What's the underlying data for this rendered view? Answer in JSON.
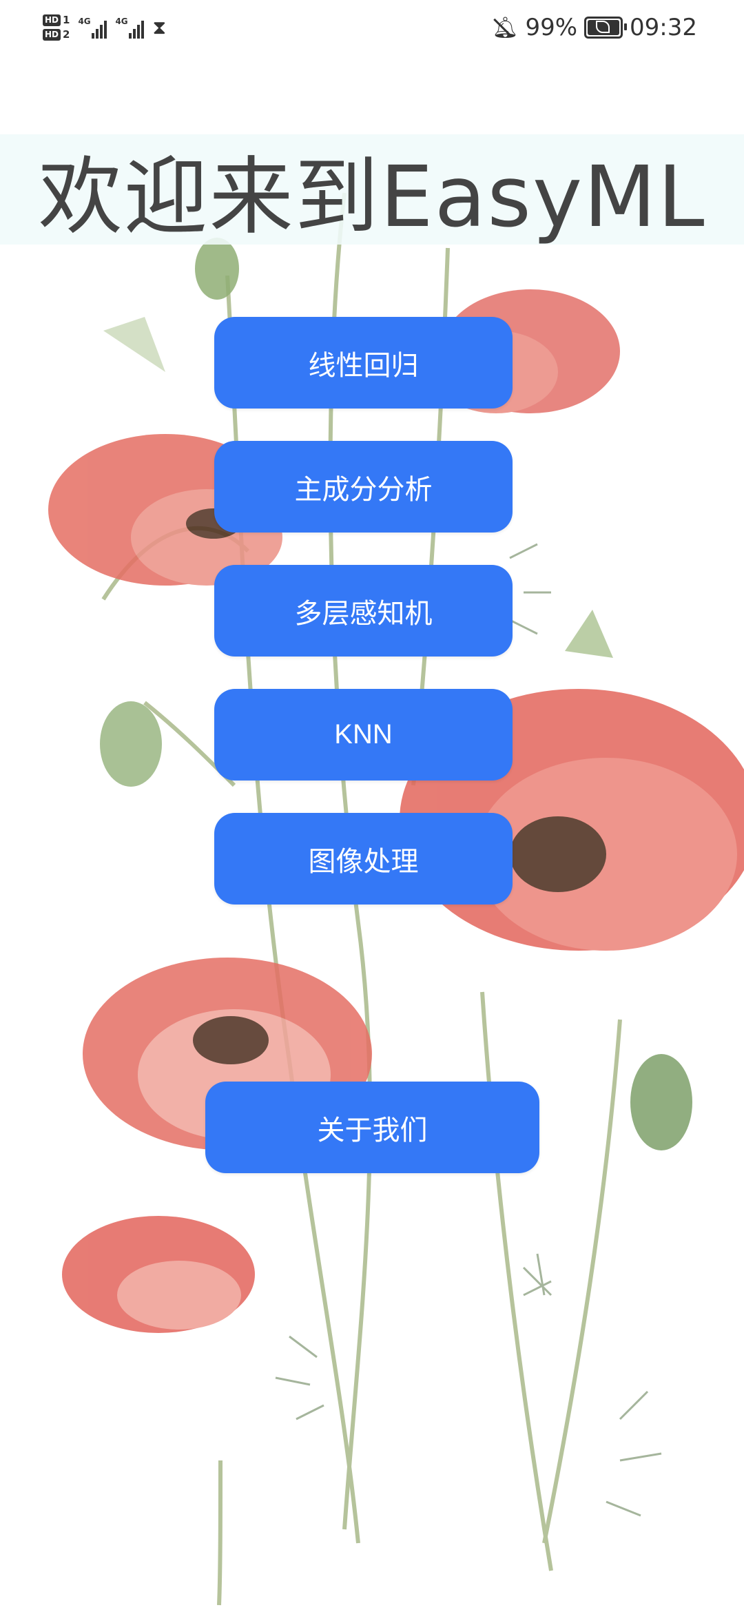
{
  "status_bar": {
    "sim1_label": "HD",
    "sim1_index": "1",
    "sim2_label": "HD",
    "sim2_index": "2",
    "network1": "4G",
    "network2": "4G",
    "battery_percent": "99%",
    "time": "09:32",
    "icons": [
      "hourglass-icon",
      "bell-muted-icon",
      "battery-saver-icon"
    ]
  },
  "header": {
    "title": "欢迎来到EasyML"
  },
  "menu": {
    "linear_regression": "线性回归",
    "pca": "主成分分析",
    "mlp": "多层感知机",
    "knn": "KNN",
    "image_processing": "图像处理",
    "about_us": "关于我们"
  },
  "theme": {
    "button_color": "#3478f6",
    "title_banner_color": "#f0fafa",
    "title_text_color": "#444444"
  }
}
